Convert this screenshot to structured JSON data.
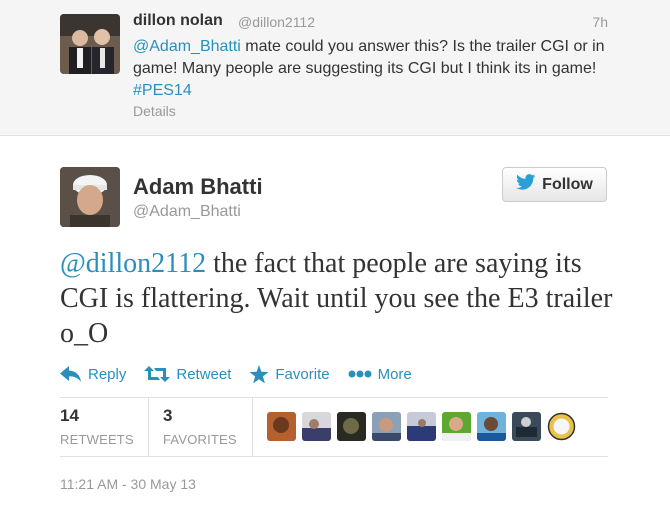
{
  "parent_tweet": {
    "name": "dillon nolan",
    "handle": "@dillon2112",
    "time": "7h",
    "mention": "@Adam_Bhatti",
    "text_body": " mate could you answer this? Is the trailer CGI or in game! Many people are suggesting its CGI but I think its in game! ",
    "hashtag": "#PES14",
    "details_label": "Details"
  },
  "main_tweet": {
    "name": "Adam Bhatti",
    "handle": "@Adam_Bhatti",
    "follow_label": "Follow",
    "mention": "@dillon2112",
    "text_body": " the fact that people are saying its CGI is flattering. Wait until you see the E3 trailer o_O"
  },
  "actions": {
    "reply": "Reply",
    "retweet": "Retweet",
    "favorite": "Favorite",
    "more": "More"
  },
  "stats": {
    "retweets_count": "14",
    "retweets_label": "RETWEETS",
    "favorites_count": "3",
    "favorites_label": "FAVORITES"
  },
  "timestamp": "11:21 AM - 30 May 13",
  "colors": {
    "link": "#2a8fbd",
    "muted": "#999999",
    "parent_background": "#f5f5f5",
    "twitter_bird": "#2a9fd6"
  }
}
